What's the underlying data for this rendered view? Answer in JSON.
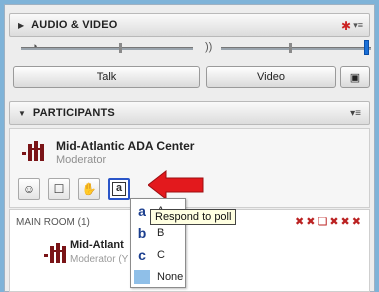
{
  "audio_video": {
    "title": "AUDIO & VIDEO",
    "talk_label": "Talk",
    "video_label": "Video",
    "mic_volume_fraction": 0.45,
    "speaker_volume_fraction": 1.0
  },
  "participants": {
    "title": "PARTICIPANTS",
    "organization": {
      "name": "Mid-Atlantic ADA Center",
      "role": "Moderator"
    }
  },
  "main_room": {
    "label": "MAIN ROOM (1)",
    "attendee": {
      "name": "Mid-Atlant",
      "role": "Moderator (Y"
    }
  },
  "poll": {
    "tooltip": "Respond to poll",
    "button_glyph": "a",
    "options": [
      {
        "key": "a",
        "label": "A"
      },
      {
        "key": "b",
        "label": "B"
      },
      {
        "key": "c",
        "label": "C"
      },
      {
        "key": "",
        "label": "None"
      }
    ]
  },
  "colors": {
    "background": "#7fb3d8",
    "poll_border": "#2a55c8",
    "arrow": "#e3191d",
    "logo": "#7a1417"
  }
}
